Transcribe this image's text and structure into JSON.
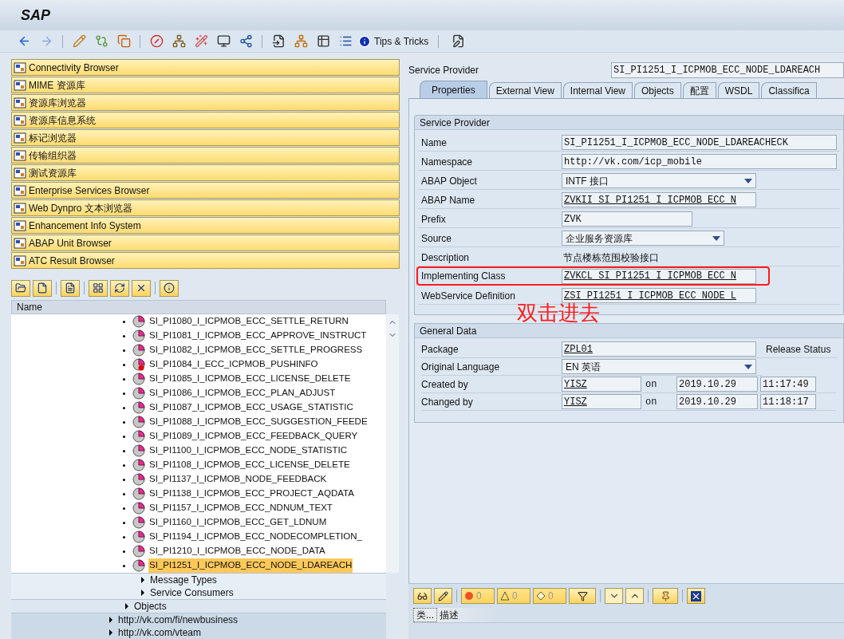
{
  "window": {
    "title": "SAP"
  },
  "toolbar": {
    "tips_label": "Tips & Tricks"
  },
  "browsers": [
    {
      "label": "Connectivity Browser"
    },
    {
      "label": "MIME 资源库"
    },
    {
      "label": "资源库浏览器"
    },
    {
      "label": "资源库信息系统"
    },
    {
      "label": "标记浏览器"
    },
    {
      "label": "传输组织器"
    },
    {
      "label": "测试资源库"
    },
    {
      "label": "Enterprise Services Browser"
    },
    {
      "label": "Web Dynpro 文本浏览器"
    },
    {
      "label": "Enhancement Info System"
    },
    {
      "label": "ABAP Unit Browser"
    },
    {
      "label": "ATC Result Browser"
    }
  ],
  "tree": {
    "header": "Name",
    "items": [
      {
        "label": "SI_PI1080_I_ICPMOB_ECC_SETTLE_RETURN",
        "kind": "ok",
        "selected": false
      },
      {
        "label": "SI_PI1081_I_ICPMOB_ECC_APPROVE_INSTRUCT",
        "kind": "ok",
        "selected": false
      },
      {
        "label": "SI_PI1082_I_ICPMOB_ECC_SETTLE_PROGRESS",
        "kind": "ok",
        "selected": false
      },
      {
        "label": "SI_PI1084_I_ECC_ICPMOB_PUSHINFO",
        "kind": "error",
        "selected": false
      },
      {
        "label": "SI_PI1085_I_ICPMOB_ECC_LICENSE_DELETE",
        "kind": "ok",
        "selected": false
      },
      {
        "label": "SI_PI1086_I_ICPMOB_ECC_PLAN_ADJUST",
        "kind": "ok",
        "selected": false
      },
      {
        "label": "SI_PI1087_I_ICPMOB_ECC_USAGE_STATISTIC",
        "kind": "ok",
        "selected": false
      },
      {
        "label": "SI_PI1088_I_ICPMOB_ECC_SUGGESTION_FEEDE",
        "kind": "ok",
        "selected": false
      },
      {
        "label": "SI_PI1089_I_ICPMOB_ECC_FEEDBACK_QUERY",
        "kind": "ok",
        "selected": false
      },
      {
        "label": "SI_PI1100_I_ICPMOB_ECC_NODE_STATISTIC",
        "kind": "ok",
        "selected": false
      },
      {
        "label": "SI_PI1108_I_ICPMOB_ECC_LICENSE_DELETE",
        "kind": "ok",
        "selected": false
      },
      {
        "label": "SI_PI1137_I_ICPMOB_NODE_FEEDBACK",
        "kind": "ok",
        "selected": false
      },
      {
        "label": "SI_PI1138_I_ICPMOB_ECC_PROJECT_AQDATA",
        "kind": "ok",
        "selected": false
      },
      {
        "label": "SI_PI1157_I_ICPMOB_ECC_NDNUM_TEXT",
        "kind": "ok",
        "selected": false
      },
      {
        "label": "SI_PI1160_I_ICPMOB_ECC_GET_LDNUM",
        "kind": "ok",
        "selected": false
      },
      {
        "label": "SI_PI1194_I_ICPMOB_ECC_NODECOMPLETION_",
        "kind": "ok",
        "selected": false
      },
      {
        "label": "SI_PI1210_I_ICPMOB_ECC_NODE_DATA",
        "kind": "ok",
        "selected": false
      },
      {
        "label": "SI_PI1251_I_ICPMOB_ECC_NODE_LDAREACH",
        "kind": "ok",
        "selected": true
      }
    ],
    "siblings": [
      {
        "label": "Message Types",
        "expanded": false
      },
      {
        "label": "Service Consumers",
        "expanded": false
      }
    ],
    "parent_siblings": [
      {
        "label": "Objects",
        "expanded": false
      }
    ],
    "namespaces": [
      {
        "label": "http://vk.com/fi/newbusiness",
        "expanded": false
      },
      {
        "label": "http://vk.com/vteam",
        "expanded": false
      }
    ]
  },
  "header": {
    "label": "Service Provider",
    "value": "SI_PI1251_I_ICPMOB_ECC_NODE_LDAREACH"
  },
  "tabs": [
    {
      "label": "Properties",
      "selected": true
    },
    {
      "label": "External View",
      "selected": false
    },
    {
      "label": "Internal View",
      "selected": false
    },
    {
      "label": "Objects",
      "selected": false
    },
    {
      "label": "配置",
      "selected": false
    },
    {
      "label": "WSDL",
      "selected": false
    },
    {
      "label": "Classifica",
      "selected": false
    }
  ],
  "service_provider": {
    "title": "Service Provider",
    "fields": [
      {
        "label": "Name",
        "value": "SI_PI1251_I_ICPMOB_ECC_NODE_LDAREACHECK",
        "kind": "text",
        "highlighted": false
      },
      {
        "label": "Namespace",
        "value": "http://vk.com/icp_mobile",
        "kind": "text",
        "highlighted": false
      },
      {
        "label": "ABAP Object",
        "value": "INTF 接口",
        "kind": "dropdown",
        "highlighted": false
      },
      {
        "label": "ABAP Name",
        "value": "ZVKII_SI_PI1251_I_ICPMOB_ECC_N",
        "kind": "link",
        "highlighted": false
      },
      {
        "label": "Prefix",
        "value": "ZVK",
        "kind": "text",
        "highlighted": false
      },
      {
        "label": "Source",
        "value": "企业服务资源库",
        "kind": "dropdown",
        "highlighted": false
      },
      {
        "label": "Description",
        "value": "节点楼栋范围校验接口",
        "kind": "plain",
        "highlighted": false
      },
      {
        "label": "Implementing Class",
        "value": "ZVKCL_SI_PI1251_I_ICPMOB_ECC_N",
        "kind": "link",
        "highlighted": true
      },
      {
        "label": "WebService Definition",
        "value": "ZSI_PI1251_I_ICPMOB_ECC_NODE_L",
        "kind": "link",
        "highlighted": false
      }
    ]
  },
  "annotation": "双击进去",
  "general_data": {
    "title": "General Data",
    "package_label": "Package",
    "package": "ZPL01",
    "release_status_label": "Release Status",
    "language_label": "Original Language",
    "language": "EN 英语",
    "rows": [
      {
        "label": "Created by",
        "user": "YISZ",
        "on": "on",
        "date": "2019.10.29",
        "time": "11:17:49"
      },
      {
        "label": "Changed by",
        "user": "YISZ",
        "on": "on",
        "date": "2019.10.29",
        "time": "11:18:17"
      }
    ]
  },
  "messages": {
    "counts": [
      "0",
      "0",
      "0"
    ],
    "columns": [
      "类...",
      "描述"
    ]
  }
}
